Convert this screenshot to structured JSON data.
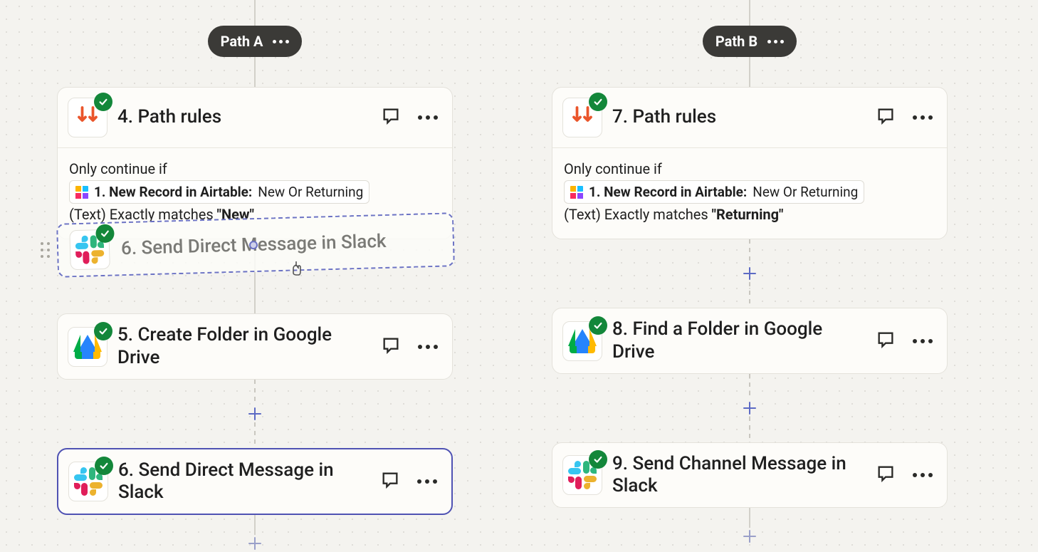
{
  "pathA": {
    "label": "Path A",
    "rules_title": "4. Path rules",
    "condition_prefix": "Only continue if ",
    "chip_text": "1. New Record in Airtable:",
    "chip_field": " New Or Returning",
    "condition_line2_pre": "(Text) Exactly matches ",
    "condition_match": "\"New\"",
    "step5_title": "5. Create Folder in Google Drive",
    "step6_title": "6. Send Direct Message in Slack",
    "ghost_title": "6. Send Direct Message in Slack"
  },
  "pathB": {
    "label": "Path B",
    "rules_title": "7. Path rules",
    "condition_prefix": "Only continue if ",
    "chip_text": "1. New Record in Airtable:",
    "chip_field": " New Or Returning",
    "condition_line2_pre": "(Text) Exactly matches ",
    "condition_match": "\"Returning\"",
    "step8_title": "8. Find a Folder in Google Drive",
    "step9_title": "9. Send Channel Message in Slack"
  }
}
